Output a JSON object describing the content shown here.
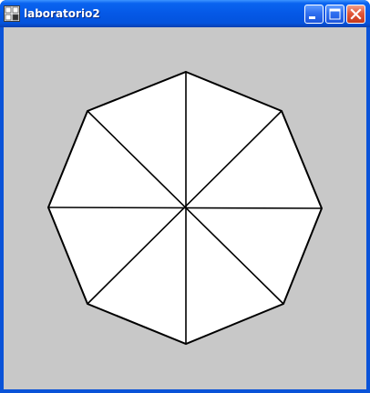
{
  "window": {
    "title": "laboratorio2",
    "icon": "java-app-icon",
    "buttons": {
      "minimize": "minimize-icon",
      "maximize": "maximize-icon",
      "close": "close-icon"
    }
  },
  "canvas": {
    "background": "#c8c8c8",
    "shape": "octagon",
    "fill": "#ffffff",
    "stroke": "#000000",
    "segments": 8
  }
}
